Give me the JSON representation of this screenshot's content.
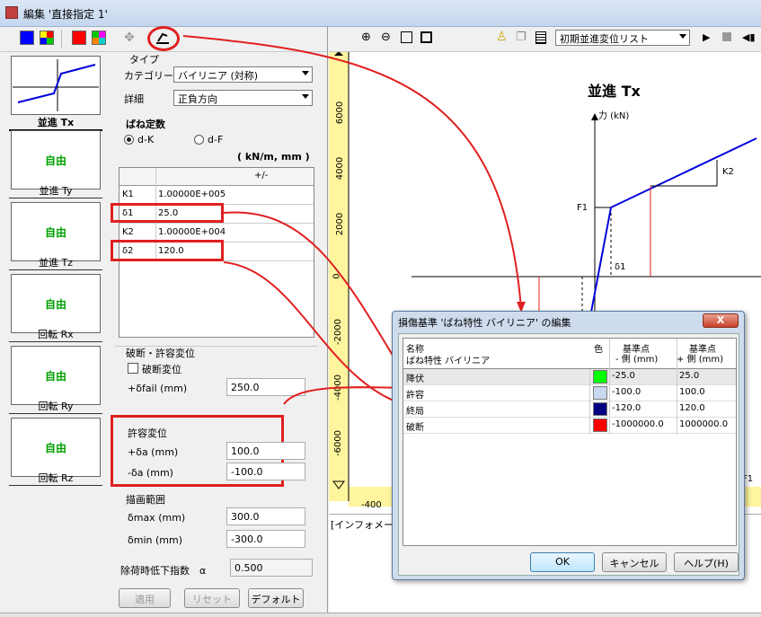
{
  "window": {
    "title": "編集 '直接指定 1'"
  },
  "graph_toolbar": {
    "dropdown_value": "初期並進変位リスト"
  },
  "thumbs": [
    {
      "label": "並進 Tx",
      "status": ""
    },
    {
      "label": "並進 Ty",
      "status": "自由"
    },
    {
      "label": "並進 Tz",
      "status": "自由"
    },
    {
      "label": "回転 Rx",
      "status": "自由"
    },
    {
      "label": "回転 Ry",
      "status": "自由"
    },
    {
      "label": "回転 Rz",
      "status": "自由"
    }
  ],
  "type": {
    "heading": "タイプ",
    "category_label": "カテゴリー",
    "category_value": "バイリニア (対称)",
    "detail_label": "詳細",
    "detail_value": "正負方向"
  },
  "spring": {
    "heading": "ばね定数",
    "radio1": "d-K",
    "radio2": "d-F",
    "unit": "( kN/m, mm )",
    "col_header": "+/-",
    "rows": [
      {
        "k": "K1",
        "v": "1.00000E+005"
      },
      {
        "k": "δ1",
        "v": "25.0"
      },
      {
        "k": "K2",
        "v": "1.00000E+004"
      },
      {
        "k": "δ2",
        "v": "120.0"
      }
    ]
  },
  "fail": {
    "heading": "破断・許容変位",
    "check_label": "破断変位",
    "field_label": "+δfail (mm)",
    "field_value": "250.0"
  },
  "allow": {
    "heading": "許容変位",
    "plus_label": "+δa (mm)",
    "plus_value": "100.0",
    "minus_label": "-δa (mm)",
    "minus_value": "-100.0"
  },
  "draw": {
    "heading": "描画範囲",
    "max_label": "δmax (mm)",
    "max_value": "300.0",
    "min_label": "δmin (mm)",
    "min_value": "-300.0"
  },
  "unload": {
    "label": "除荷時低下指数　α",
    "value": "0.500"
  },
  "buttons": {
    "apply": "適用",
    "reset": "リセット",
    "default": "デフォルト"
  },
  "graph": {
    "title": "並進 Tx",
    "force_label": "力 (kN)",
    "F1": "F1",
    "K2": "K2",
    "d1": "δ1",
    "y_ticks": [
      "6000",
      "4000",
      "2000",
      "0",
      "-2000",
      "-4000",
      "-6000"
    ],
    "x_tick": "-400",
    "right_tick": "F1"
  },
  "info": {
    "text": "[インフォメーション"
  },
  "dialog": {
    "title": "損傷基準 'ばね特性 バイリニア' の編集",
    "close": "X",
    "h_name1": "名称",
    "h_name2": "ばね特性 バイリニア",
    "h_color": "色",
    "h_minus1": "基準点",
    "h_minus2": "- 側 (mm)",
    "h_plus1": "基準点",
    "h_plus2": "+ 側 (mm)",
    "rows": [
      {
        "name": "降伏",
        "color": "#00ff00",
        "minus": "-25.0",
        "plus": "25.0"
      },
      {
        "name": "許容",
        "color": "#c8d8ee",
        "minus": "-100.0",
        "plus": "100.0"
      },
      {
        "name": "終局",
        "color": "#000080",
        "minus": "-120.0",
        "plus": "120.0"
      },
      {
        "name": "破断",
        "color": "#ff0000",
        "minus": "-1000000.0",
        "plus": "1000000.0"
      }
    ],
    "ok": "OK",
    "cancel": "キャンセル",
    "help": "ヘルプ(H)"
  }
}
